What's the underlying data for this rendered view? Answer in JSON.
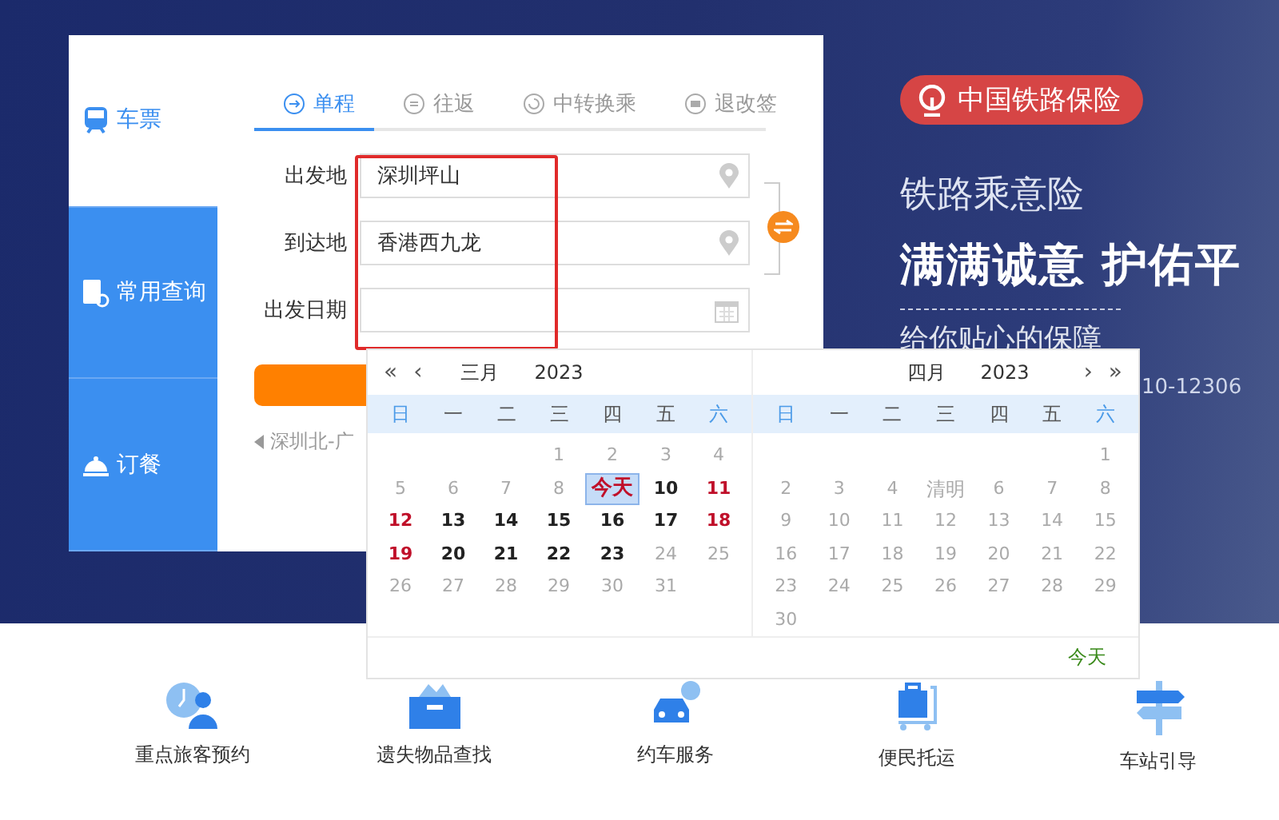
{
  "side_tabs": [
    {
      "label": "车票",
      "selected": true
    },
    {
      "label": "常用查询",
      "selected": false
    },
    {
      "label": "订餐",
      "selected": false
    }
  ],
  "trip_tabs": [
    {
      "label": "单程",
      "selected": true
    },
    {
      "label": "往返",
      "selected": false
    },
    {
      "label": "中转换乘",
      "selected": false
    },
    {
      "label": "退改签",
      "selected": false
    }
  ],
  "form": [
    {
      "label": "出发地",
      "value": "深圳坪山"
    },
    {
      "label": "到达地",
      "value": "香港西九龙"
    },
    {
      "label": "出发日期"
    }
  ],
  "recent_route": "深圳北-广",
  "banner": {
    "badge": "中国铁路保险",
    "title": "铁路乘意险",
    "slogan": "满满诚意 护佑平",
    "subtitle": "给你贴心的保障",
    "phone": "10-12306"
  },
  "calendar": {
    "months": [
      {
        "month": "三月",
        "year": "2023",
        "nav": [
          "«",
          "‹"
        ],
        "weekdays": [
          "日",
          "一",
          "二",
          "三",
          "四",
          "五",
          "六"
        ],
        "cells": [
          {
            "kind": "blank"
          },
          {
            "kind": "blank"
          },
          {
            "kind": "blank"
          },
          {
            "day": "1",
            "kind": "past"
          },
          {
            "day": "2",
            "kind": "past"
          },
          {
            "day": "3",
            "kind": "past"
          },
          {
            "day": "4",
            "kind": "past"
          },
          {
            "day": "5",
            "kind": "past"
          },
          {
            "day": "6",
            "kind": "past"
          },
          {
            "day": "7",
            "kind": "past"
          },
          {
            "day": "8",
            "kind": "past"
          },
          {
            "day": "今天",
            "kind": "today"
          },
          {
            "day": "10",
            "kind": "open"
          },
          {
            "day": "11",
            "kind": "holiday"
          },
          {
            "day": "12",
            "kind": "holiday"
          },
          {
            "day": "13",
            "kind": "open"
          },
          {
            "day": "14",
            "kind": "open"
          },
          {
            "day": "15",
            "kind": "open"
          },
          {
            "day": "16",
            "kind": "open"
          },
          {
            "day": "17",
            "kind": "open"
          },
          {
            "day": "18",
            "kind": "holiday"
          },
          {
            "day": "19",
            "kind": "holiday"
          },
          {
            "day": "20",
            "kind": "open"
          },
          {
            "day": "21",
            "kind": "open"
          },
          {
            "day": "22",
            "kind": "open"
          },
          {
            "day": "23",
            "kind": "open"
          },
          {
            "day": "24",
            "kind": "past"
          },
          {
            "day": "25",
            "kind": "past"
          },
          {
            "day": "26",
            "kind": "past"
          },
          {
            "day": "27",
            "kind": "past"
          },
          {
            "day": "28",
            "kind": "past"
          },
          {
            "day": "29",
            "kind": "past"
          },
          {
            "day": "30",
            "kind": "past"
          },
          {
            "day": "31",
            "kind": "past"
          }
        ]
      },
      {
        "month": "四月",
        "year": "2023",
        "nav": [
          "›",
          "»"
        ],
        "weekdays": [
          "日",
          "一",
          "二",
          "三",
          "四",
          "五",
          "六"
        ],
        "cells": [
          {
            "kind": "blank"
          },
          {
            "kind": "blank"
          },
          {
            "kind": "blank"
          },
          {
            "kind": "blank"
          },
          {
            "kind": "blank"
          },
          {
            "kind": "blank"
          },
          {
            "day": "1",
            "kind": "past"
          },
          {
            "day": "2",
            "kind": "past"
          },
          {
            "day": "3",
            "kind": "past"
          },
          {
            "day": "4",
            "kind": "past"
          },
          {
            "day": "清明",
            "kind": "festival"
          },
          {
            "day": "6",
            "kind": "past"
          },
          {
            "day": "7",
            "kind": "past"
          },
          {
            "day": "8",
            "kind": "past"
          },
          {
            "day": "9",
            "kind": "past"
          },
          {
            "day": "10",
            "kind": "past"
          },
          {
            "day": "11",
            "kind": "past"
          },
          {
            "day": "12",
            "kind": "past"
          },
          {
            "day": "13",
            "kind": "past"
          },
          {
            "day": "14",
            "kind": "past"
          },
          {
            "day": "15",
            "kind": "past"
          },
          {
            "day": "16",
            "kind": "past"
          },
          {
            "day": "17",
            "kind": "past"
          },
          {
            "day": "18",
            "kind": "past"
          },
          {
            "day": "19",
            "kind": "past"
          },
          {
            "day": "20",
            "kind": "past"
          },
          {
            "day": "21",
            "kind": "past"
          },
          {
            "day": "22",
            "kind": "past"
          },
          {
            "day": "23",
            "kind": "past"
          },
          {
            "day": "24",
            "kind": "past"
          },
          {
            "day": "25",
            "kind": "past"
          },
          {
            "day": "26",
            "kind": "past"
          },
          {
            "day": "27",
            "kind": "past"
          },
          {
            "day": "28",
            "kind": "past"
          },
          {
            "day": "29",
            "kind": "past"
          },
          {
            "day": "30",
            "kind": "past"
          }
        ]
      }
    ],
    "today_link": "今天"
  },
  "services": [
    {
      "label": "重点旅客预约"
    },
    {
      "label": "遗失物品查找"
    },
    {
      "label": "约车服务"
    },
    {
      "label": "便民托运"
    },
    {
      "label": "车站引导"
    }
  ]
}
